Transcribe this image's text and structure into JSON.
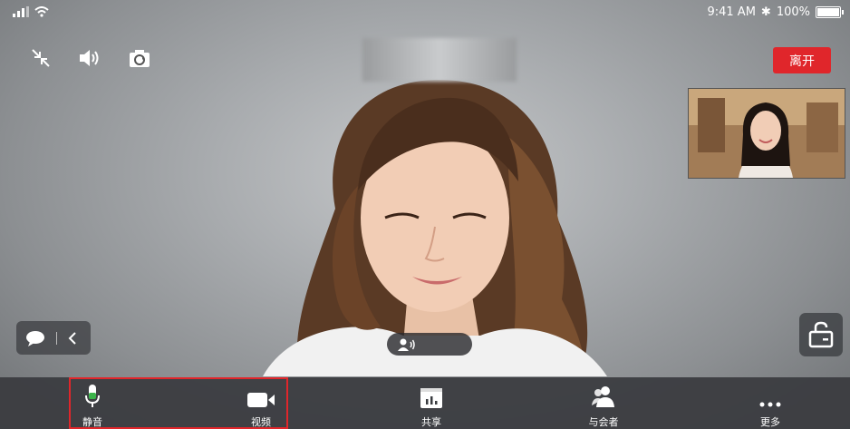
{
  "status_bar": {
    "time": "9:41 AM",
    "battery": "100%",
    "bluetooth_icon": "bluetooth-icon",
    "signal_icon": "signal-icon",
    "wifi_icon": "wifi-icon"
  },
  "top_controls": {
    "icons": [
      "collapse-icon",
      "speaker-icon",
      "camera-switch-icon"
    ]
  },
  "leave_button": {
    "label": "离开",
    "color": "#e0262b"
  },
  "toolbar": {
    "items": [
      {
        "label": "静音",
        "icon": "microphone-icon"
      },
      {
        "label": "视频",
        "icon": "video-camera-icon"
      },
      {
        "label": "共享",
        "icon": "share-screen-icon"
      },
      {
        "label": "与会者",
        "icon": "participants-icon"
      },
      {
        "label": "更多",
        "icon": "more-icon"
      }
    ]
  }
}
